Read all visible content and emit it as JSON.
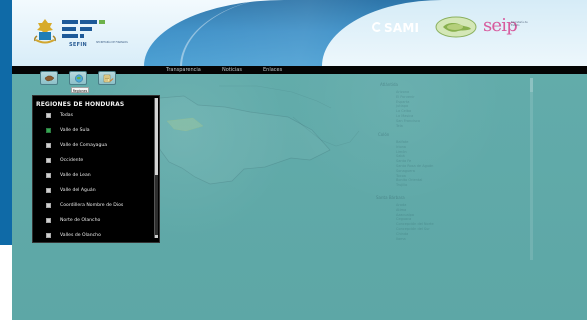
{
  "header": {
    "brand_text": "SEFIN",
    "brand_subtext": "SECRETARÍA DE FINANZAS",
    "partner_logo_sami": "SAMI",
    "partner_logo_seip": "seip"
  },
  "navbar": {
    "items": [
      "Transparencia",
      "Noticias",
      "Enlaces"
    ]
  },
  "toolbar": {
    "tooltip": "Regiones",
    "buttons": [
      {
        "name": "map-button",
        "icon": "honduras-map-icon"
      },
      {
        "name": "regions-button",
        "icon": "globe-icon"
      },
      {
        "name": "report-button",
        "icon": "edit-list-icon"
      }
    ]
  },
  "region_panel": {
    "title": "REGIONES DE HONDURAS",
    "items": [
      {
        "label": "Todas",
        "checked": false
      },
      {
        "label": "Valle de Sula",
        "checked": true
      },
      {
        "label": "Valle de Comayagua",
        "checked": false
      },
      {
        "label": "Occidente",
        "checked": false
      },
      {
        "label": "Valle de Lean",
        "checked": false
      },
      {
        "label": "Valle del Aguán",
        "checked": false
      },
      {
        "label": "Coordillera Nombre de Dios",
        "checked": false
      },
      {
        "label": "Norte de Olancho",
        "checked": false
      },
      {
        "label": "Valles de Olancho",
        "checked": false
      }
    ]
  },
  "map_background": {
    "labels_visible": false
  },
  "colors": {
    "navbar_bg": "#040404",
    "map_bg": "#5faaa9",
    "header_blue": "#3f91c8",
    "panel_bg": "#000000",
    "checked_green": "#35a952"
  }
}
